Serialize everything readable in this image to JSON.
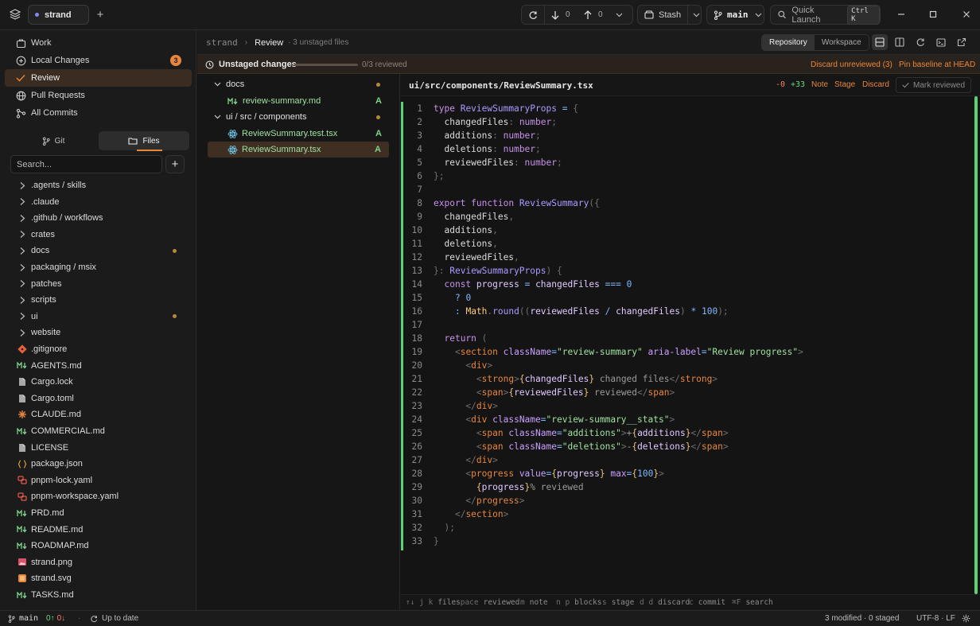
{
  "titlebar": {
    "tab_label": "strand",
    "fetch_count": "0",
    "push_count": "0",
    "stash_label": "Stash",
    "branch_label": "main",
    "quick_launch_label": "Quick Launch",
    "quick_launch_shortcut": "Ctrl K"
  },
  "sidebar": {
    "nav": [
      {
        "label": "Work"
      },
      {
        "label": "Local Changes",
        "badge": "3"
      },
      {
        "label": "Review"
      },
      {
        "label": "Pull Requests"
      },
      {
        "label": "All Commits"
      }
    ],
    "tabs": {
      "git": "Git",
      "files": "Files"
    },
    "search_placeholder": "Search...",
    "files": [
      {
        "name": ".agents / skills",
        "type": "folder"
      },
      {
        "name": ".claude",
        "type": "folder"
      },
      {
        "name": ".github / workflows",
        "type": "folder"
      },
      {
        "name": "crates",
        "type": "folder"
      },
      {
        "name": "docs",
        "type": "folder",
        "modified": true
      },
      {
        "name": "packaging / msix",
        "type": "folder"
      },
      {
        "name": "patches",
        "type": "folder"
      },
      {
        "name": "scripts",
        "type": "folder"
      },
      {
        "name": "ui",
        "type": "folder",
        "modified": true
      },
      {
        "name": "website",
        "type": "folder"
      },
      {
        "name": ".gitignore",
        "type": "git"
      },
      {
        "name": "AGENTS.md",
        "type": "md"
      },
      {
        "name": "Cargo.lock",
        "type": "file"
      },
      {
        "name": "Cargo.toml",
        "type": "file"
      },
      {
        "name": "CLAUDE.md",
        "type": "claude"
      },
      {
        "name": "COMMERCIAL.md",
        "type": "md"
      },
      {
        "name": "LICENSE",
        "type": "file"
      },
      {
        "name": "package.json",
        "type": "json"
      },
      {
        "name": "pnpm-lock.yaml",
        "type": "yaml"
      },
      {
        "name": "pnpm-workspace.yaml",
        "type": "yaml"
      },
      {
        "name": "PRD.md",
        "type": "md"
      },
      {
        "name": "README.md",
        "type": "md"
      },
      {
        "name": "ROADMAP.md",
        "type": "md"
      },
      {
        "name": "strand.png",
        "type": "image"
      },
      {
        "name": "strand.svg",
        "type": "svg"
      },
      {
        "name": "TASKS.md",
        "type": "md"
      }
    ]
  },
  "header": {
    "repo": "strand",
    "page": "Review",
    "meta": "· 3 unstaged files",
    "mode_repository": "Repository",
    "mode_workspace": "Workspace"
  },
  "unstaged": {
    "title": "Unstaged changes",
    "progress": 0,
    "count": "0/3 reviewed",
    "discard_unreviewed": "Discard unreviewed (3)",
    "pin_baseline": "Pin baseline at HEAD"
  },
  "changes": {
    "groups": [
      {
        "folder": "docs",
        "files": [
          {
            "name": "review-summary.md",
            "status": "A",
            "type": "md"
          }
        ]
      },
      {
        "folder": "ui / src / components",
        "files": [
          {
            "name": "ReviewSummary.test.tsx",
            "status": "A",
            "type": "react"
          },
          {
            "name": "ReviewSummary.tsx",
            "status": "A",
            "type": "react",
            "selected": true
          }
        ]
      }
    ]
  },
  "editor": {
    "path": "ui/src/components/ReviewSummary.tsx",
    "deletions": "-0",
    "additions": "+33",
    "note": "Note",
    "stage": "Stage",
    "discard": "Discard",
    "mark_reviewed": "Mark reviewed"
  },
  "hints": [
    {
      "keys": "↑↓ j k",
      "label": "files"
    },
    {
      "keys": "space",
      "label": "reviewed"
    },
    {
      "keys": "m",
      "label": "note"
    },
    {
      "keys": "n p",
      "label": "blocks"
    },
    {
      "keys": "s",
      "label": "stage"
    },
    {
      "keys": "d d",
      "label": "discard"
    },
    {
      "keys": "c",
      "label": "commit"
    },
    {
      "keys": "⌘F",
      "label": "search"
    }
  ],
  "status": {
    "branch": "main",
    "ahead": "0↑",
    "behind": "0↓",
    "sync": "Up to date",
    "summary": "3 modified · 0 staged",
    "encoding": "UTF-8 · LF"
  },
  "colors": {
    "accent": "#e8873a",
    "added": "#5bd276",
    "background": "#171717"
  }
}
